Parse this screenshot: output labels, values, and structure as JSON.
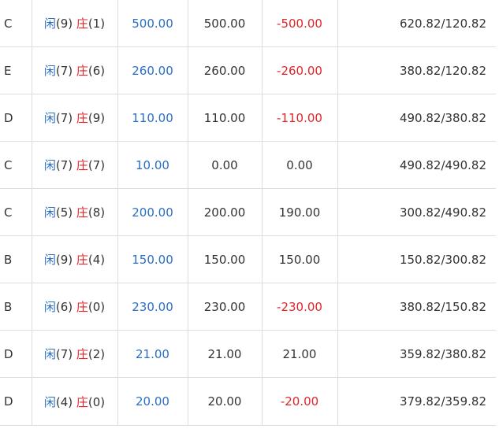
{
  "rows": [
    {
      "type": "C",
      "player_label": "闲",
      "player_score": "(9)",
      "banker_label": "庄",
      "banker_score": "(1)",
      "bet": "500.00",
      "valid": "500.00",
      "win": "-500.00",
      "win_negative": true,
      "balance": "620.82/120.82"
    },
    {
      "type": "E",
      "player_label": "闲",
      "player_score": "(7)",
      "banker_label": "庄",
      "banker_score": "(6)",
      "bet": "260.00",
      "valid": "260.00",
      "win": "-260.00",
      "win_negative": true,
      "balance": "380.82/120.82"
    },
    {
      "type": "D",
      "player_label": "闲",
      "player_score": "(7)",
      "banker_label": "庄",
      "banker_score": "(9)",
      "bet": "110.00",
      "valid": "110.00",
      "win": "-110.00",
      "win_negative": true,
      "balance": "490.82/380.82"
    },
    {
      "type": "C",
      "player_label": "闲",
      "player_score": "(7)",
      "banker_label": "庄",
      "banker_score": "(7)",
      "bet": "10.00",
      "valid": "0.00",
      "win": "0.00",
      "win_negative": false,
      "balance": "490.82/490.82"
    },
    {
      "type": "C",
      "player_label": "闲",
      "player_score": "(5)",
      "banker_label": "庄",
      "banker_score": "(8)",
      "bet": "200.00",
      "valid": "200.00",
      "win": "190.00",
      "win_negative": false,
      "balance": "300.82/490.82"
    },
    {
      "type": "B",
      "player_label": "闲",
      "player_score": "(9)",
      "banker_label": "庄",
      "banker_score": "(4)",
      "bet": "150.00",
      "valid": "150.00",
      "win": "150.00",
      "win_negative": false,
      "balance": "150.82/300.82"
    },
    {
      "type": "B",
      "player_label": "闲",
      "player_score": "(6)",
      "banker_label": "庄",
      "banker_score": "(0)",
      "bet": "230.00",
      "valid": "230.00",
      "win": "-230.00",
      "win_negative": true,
      "balance": "380.82/150.82"
    },
    {
      "type": "D",
      "player_label": "闲",
      "player_score": "(7)",
      "banker_label": "庄",
      "banker_score": "(2)",
      "bet": "21.00",
      "valid": "21.00",
      "win": "21.00",
      "win_negative": false,
      "balance": "359.82/380.82"
    },
    {
      "type": "D",
      "player_label": "闲",
      "player_score": "(4)",
      "banker_label": "庄",
      "banker_score": "(0)",
      "bet": "20.00",
      "valid": "20.00",
      "win": "-20.00",
      "win_negative": true,
      "balance": "379.82/359.82"
    }
  ],
  "colors": {
    "player": "#2b6fc4",
    "banker": "#e0262b",
    "bet": "#2b6fc4",
    "negative": "#e0262b",
    "text": "#333333",
    "border": "#dddddd"
  }
}
